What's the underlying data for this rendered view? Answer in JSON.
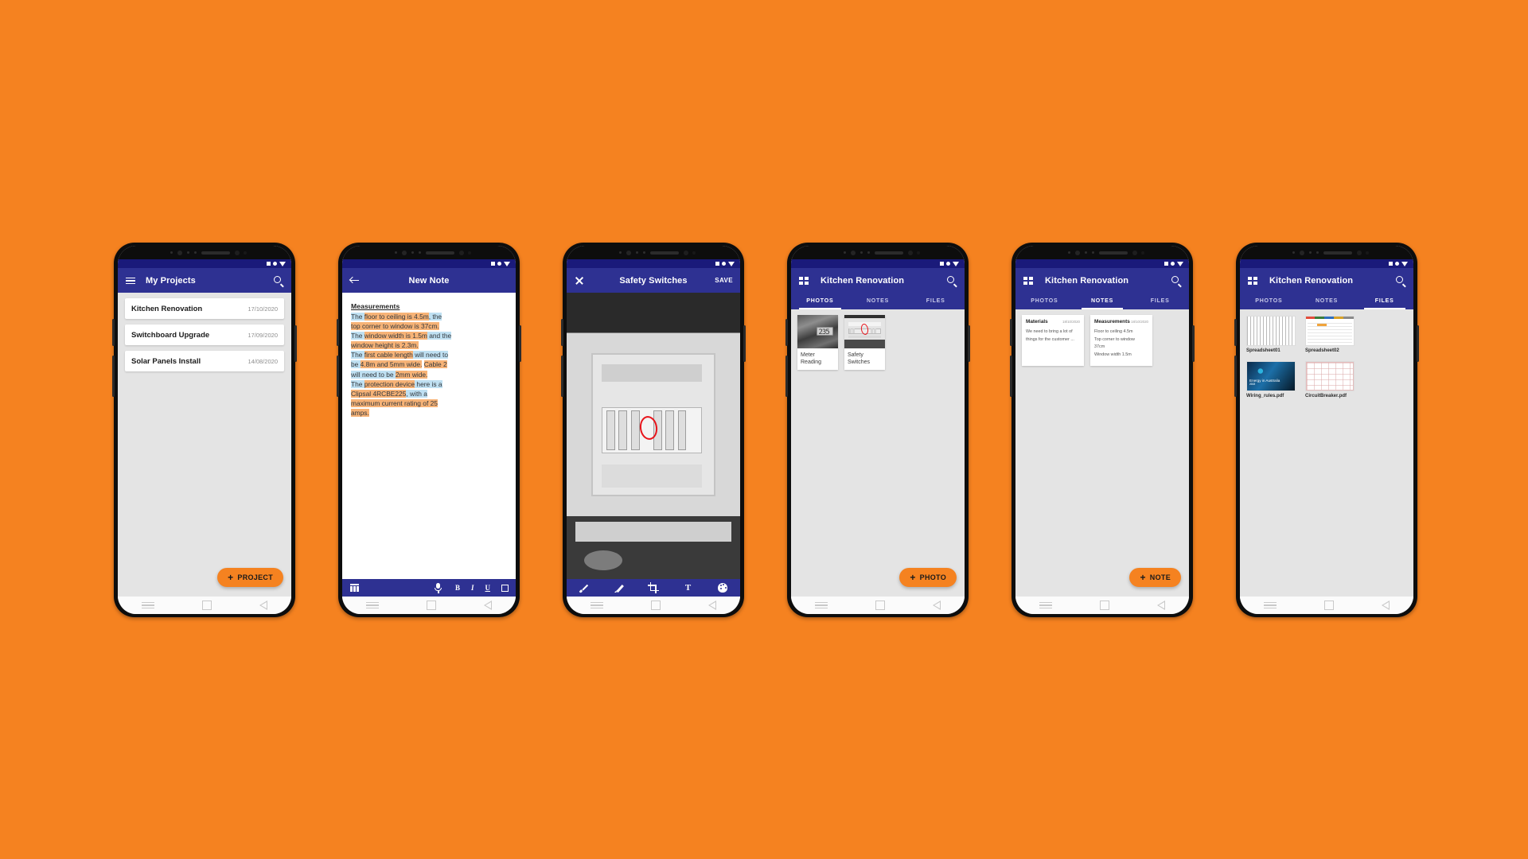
{
  "background_color": "#F58220",
  "theme": {
    "primary": "#2E3192",
    "status_bar": "#1A1A7A",
    "accent": "#F58220"
  },
  "phones": [
    {
      "id": "projects",
      "appbar": {
        "menu_icon": "hamburger-icon",
        "title": "My Projects",
        "search_icon": "search-icon"
      },
      "projects": [
        {
          "name": "Kitchen Renovation",
          "date": "17/10/2020"
        },
        {
          "name": "Switchboard Upgrade",
          "date": "17/09/2020"
        },
        {
          "name": "Solar Panels Install",
          "date": "14/08/2020"
        }
      ],
      "fab": {
        "plus": "+",
        "label": "PROJECT"
      }
    },
    {
      "id": "new-note",
      "appbar": {
        "back_icon": "back-arrow-icon",
        "title": "New Note"
      },
      "note": {
        "heading": "Measurements",
        "lines": [
          [
            {
              "t": "The ",
              "h": "b"
            },
            {
              "t": "floor to ceiling is 4.5m",
              "h": "o"
            },
            {
              "t": ", the ",
              "h": "b"
            }
          ],
          [
            {
              "t": "top corner to window is 37cm.",
              "h": "o"
            }
          ],
          [
            {
              "t": "The ",
              "h": "b"
            },
            {
              "t": "window width is 1.5m",
              "h": "o"
            },
            {
              "t": " and the ",
              "h": "b"
            }
          ],
          [
            {
              "t": "window height is 2.3m.",
              "h": "o"
            }
          ],
          [
            {
              "t": "The ",
              "h": "b"
            },
            {
              "t": "first cable length",
              "h": "o"
            },
            {
              "t": " will need to ",
              "h": "b"
            }
          ],
          [
            {
              "t": "be ",
              "h": "b"
            },
            {
              "t": "4.8m and 5mm wide.",
              "h": "o"
            },
            {
              "t": " ",
              "h": ""
            },
            {
              "t": "Cable 2",
              "h": "o"
            }
          ],
          [
            {
              "t": "will need to be ",
              "h": "b"
            },
            {
              "t": "2mm wide.",
              "h": "o"
            }
          ],
          [
            {
              "t": "The ",
              "h": "b"
            },
            {
              "t": "protection device",
              "h": "o"
            },
            {
              "t": " here is a ",
              "h": "b"
            }
          ],
          [
            {
              "t": "Clipsal 4RCBE225",
              "h": "o"
            },
            {
              "t": ", with a ",
              "h": "b"
            }
          ],
          [
            {
              "t": "maximum current rating of 25",
              "h": "o"
            }
          ],
          [
            {
              "t": "amps.",
              "h": "o"
            }
          ]
        ]
      },
      "toolbar": {
        "table_icon": "table-icon",
        "mic_icon": "microphone-icon",
        "bold": "B",
        "italic": "I",
        "underline": "U",
        "highlight_icon": "highlight-square-icon"
      }
    },
    {
      "id": "photo-editor",
      "appbar": {
        "close_icon": "close-icon",
        "title": "Safety Switches",
        "save_label": "SAVE"
      },
      "toolbar": {
        "brush_icon": "brush-icon",
        "pen_icon": "pen-icon",
        "crop_icon": "crop-icon",
        "text_icon": "text-tool-icon",
        "palette_icon": "color-palette-icon"
      }
    },
    {
      "id": "project-photos",
      "appbar": {
        "grid_icon": "grid-icon",
        "title": "Kitchen Renovation",
        "search_icon": "search-icon"
      },
      "tabs": [
        {
          "label": "PHOTOS",
          "active": true
        },
        {
          "label": "NOTES",
          "active": false
        },
        {
          "label": "FILES",
          "active": false
        }
      ],
      "photos": [
        {
          "caption": "Meter Reading",
          "thumb": "multimeter-photo",
          "value": "235"
        },
        {
          "caption": "Safety Switches",
          "thumb": "switchboard-photo",
          "annotated": true
        }
      ],
      "fab": {
        "plus": "+",
        "label": "PHOTO"
      }
    },
    {
      "id": "project-notes",
      "appbar": {
        "grid_icon": "grid-icon",
        "title": "Kitchen Renovation",
        "search_icon": "search-icon"
      },
      "tabs": [
        {
          "label": "PHOTOS",
          "active": false
        },
        {
          "label": "NOTES",
          "active": true
        },
        {
          "label": "FILES",
          "active": false
        }
      ],
      "notes": [
        {
          "title": "Materials",
          "date": "18/10/2020",
          "body": [
            "We need to bring a lot of",
            "things for the customer ..."
          ]
        },
        {
          "title": "Measurements",
          "date": "18/10/2020",
          "body": [
            "Floor to ceiling 4.5m",
            "Top corner to window",
            "37cm",
            "Window width 1.5m"
          ]
        }
      ],
      "fab": {
        "plus": "+",
        "label": "NOTE"
      }
    },
    {
      "id": "project-files",
      "appbar": {
        "grid_icon": "grid-icon",
        "title": "Kitchen Renovation",
        "search_icon": "search-icon"
      },
      "tabs": [
        {
          "label": "PHOTOS",
          "active": false
        },
        {
          "label": "NOTES",
          "active": false
        },
        {
          "label": "FILES",
          "active": true
        }
      ],
      "files": [
        {
          "name": "Spreadsheet01",
          "kind": "spreadsheet-printout"
        },
        {
          "name": "Spreadsheet02",
          "kind": "spreadsheet-screenshot"
        },
        {
          "name": "Wiring_rules.pdf",
          "kind": "pdf-cover",
          "cover_title": "Energy in Australia",
          "cover_year": "2015"
        },
        {
          "name": "CircuitBreaker.pdf",
          "kind": "pdf-schematic"
        }
      ]
    }
  ]
}
